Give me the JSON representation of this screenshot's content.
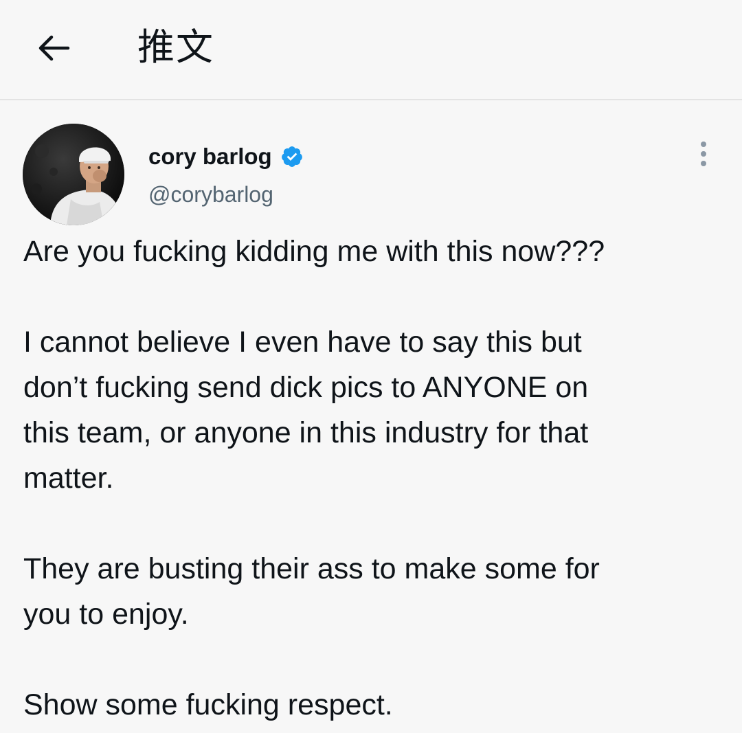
{
  "header": {
    "back_icon": "arrow-left-icon",
    "title": "推文"
  },
  "author": {
    "display_name": "cory barlog",
    "handle": "@corybarlog",
    "verified_icon": "verified-badge-icon",
    "avatar_icon": "avatar-photo",
    "verified_color": "#1d9bf0"
  },
  "more_icon": "more-vertical-icon",
  "tweet": {
    "paragraphs": [
      "Are you fucking kidding me with this now???",
      "I cannot believe I even have to say this but\ndon’t fucking send dick pics to ANYONE on\nthis team, or anyone in this industry for that\nmatter.",
      "They are busting their ass to make some for\nyou to enjoy.",
      "Show some fucking respect."
    ]
  },
  "colors": {
    "background": "#f7f7f7",
    "text": "#0f1419",
    "secondary_text": "#536471",
    "divider": "#e3e3e3"
  }
}
